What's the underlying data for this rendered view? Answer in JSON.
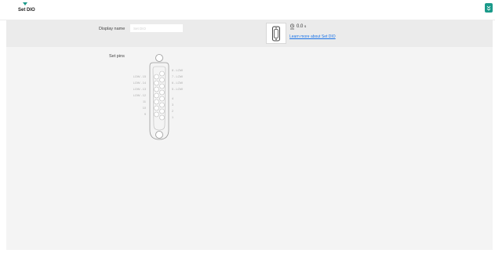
{
  "header": {
    "title": "Set DIO"
  },
  "form": {
    "display_name_label": "Display name",
    "display_name_placeholder": "Set DIO",
    "set_pins_label": "Set pins"
  },
  "info": {
    "time_value": "0.0",
    "time_unit": "s",
    "learn_more_link": "Learn more about Set DIO"
  },
  "pins": {
    "left_column": [
      {
        "label": "LOW - 15"
      },
      {
        "label": "LOW - 14"
      },
      {
        "label": "LOW - 13"
      },
      {
        "label": "LOW - 12"
      },
      {
        "label": "11"
      },
      {
        "label": "10"
      },
      {
        "label": "9"
      }
    ],
    "right_column": [
      {
        "label": "8 - LOW"
      },
      {
        "label": "7 - LOW"
      },
      {
        "label": "6 - LOW"
      },
      {
        "label": "5 - LOW"
      },
      {
        "label": "4"
      },
      {
        "label": "3"
      },
      {
        "label": "2"
      },
      {
        "label": "1"
      }
    ]
  },
  "colors": {
    "accent": "#1a9a8a",
    "link": "#1a73e8",
    "band": "#ebebeb",
    "panel": "#f4f4f4"
  },
  "icons": {
    "caret": "caret-down-icon",
    "collapse": "double-chevron-down-icon",
    "device": "connector-device-icon",
    "timer": "timer-icon"
  }
}
